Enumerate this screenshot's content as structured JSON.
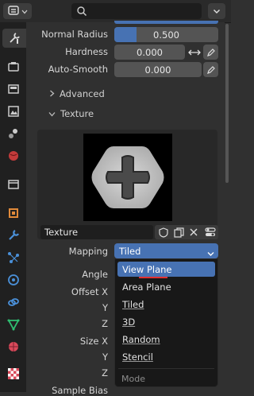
{
  "header": {
    "editor_icon": "properties-editor-icon",
    "search_icon": "search-icon",
    "dropdown_icon": "chevron-down-icon"
  },
  "tabs": [
    {
      "name": "tool-tab-icon",
      "active": true
    },
    {
      "name": "render-tab-icon"
    },
    {
      "name": "output-tab-icon"
    },
    {
      "name": "view-layer-tab-icon"
    },
    {
      "name": "scene-tab-icon"
    },
    {
      "name": "world-tab-icon"
    },
    {
      "name": "collection-tab-icon"
    },
    {
      "name": "object-tab-icon"
    },
    {
      "name": "modifier-tab-icon"
    },
    {
      "name": "particles-tab-icon"
    },
    {
      "name": "physics-tab-icon"
    },
    {
      "name": "constraints-tab-icon"
    },
    {
      "name": "data-tab-icon"
    },
    {
      "name": "material-tab-icon"
    },
    {
      "name": "texture-tab-icon"
    }
  ],
  "props": {
    "normal_radius_label": "Normal Radius",
    "normal_radius_value": "0.500",
    "normal_radius_fraction": 0.21,
    "hardness_label": "Hardness",
    "hardness_value": "0.000",
    "autosmooth_label": "Auto-Smooth",
    "autosmooth_value": "0.000"
  },
  "panels": {
    "advanced": "Advanced",
    "texture": "Texture"
  },
  "texture": {
    "name": "Texture",
    "mapping_label": "Mapping",
    "mapping_value": "Tiled",
    "angle_label": "Angle",
    "offset_x_label": "Offset X",
    "offset_y_label": "Y",
    "offset_z_label": "Z",
    "size_x_label": "Size X",
    "size_y_label": "Y",
    "size_z_label": "Z",
    "sample_bias_label": "Sample Bias"
  },
  "menu": {
    "items": [
      "View Plane",
      "Area Plane",
      "Tiled",
      "3D",
      "Random",
      "Stencil"
    ],
    "highlighted": "View Plane",
    "title": "Mode"
  },
  "colors": {
    "accent": "#4772b3",
    "underline_red": "#e03030"
  }
}
